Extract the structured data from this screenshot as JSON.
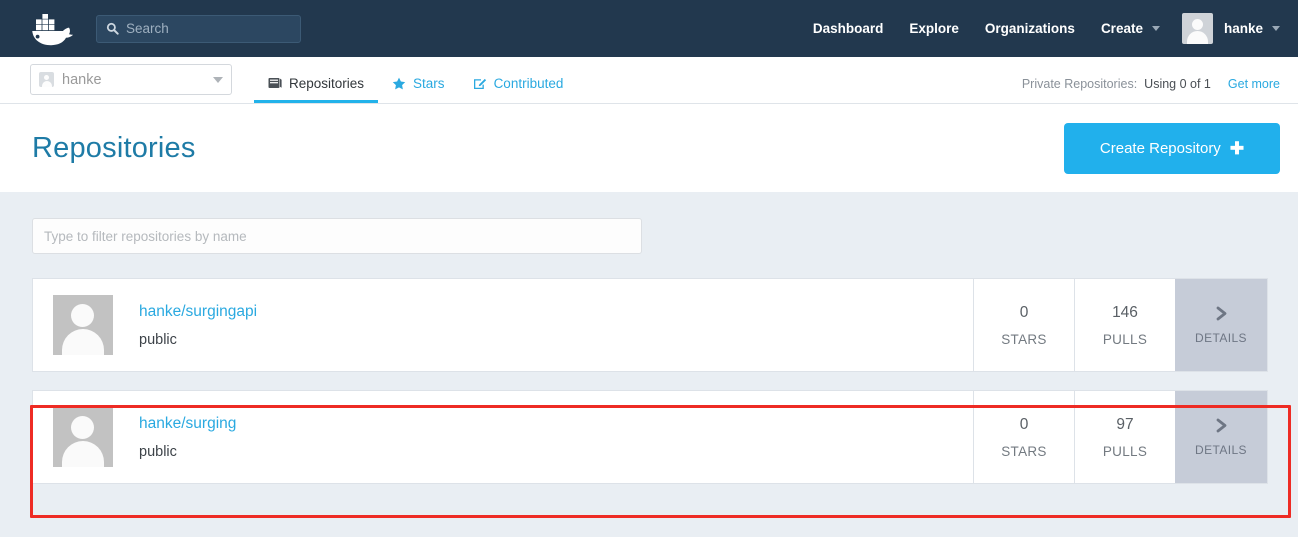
{
  "topnav": {
    "logo_icon": "docker-whale-logo",
    "search": {
      "icon": "search-icon",
      "placeholder": "Search",
      "value": ""
    },
    "links": [
      {
        "label": "Dashboard",
        "name": "dashboard"
      },
      {
        "label": "Explore",
        "name": "explore"
      },
      {
        "label": "Organizations",
        "name": "organizations"
      }
    ],
    "create_menu": {
      "label": "Create",
      "caret_icon": "chevron-down-icon"
    },
    "user_menu": {
      "label": "hanke",
      "avatar_icon": "user-avatar-icon",
      "caret_icon": "chevron-down-icon"
    },
    "bg_color": "#22384e"
  },
  "subheader": {
    "account_select": {
      "value": "hanke",
      "avatar_icon": "user-avatar-icon",
      "caret_icon": "caret-down-icon"
    },
    "tabs": [
      {
        "label": "Repositories",
        "icon": "book-icon",
        "active": true
      },
      {
        "label": "Stars",
        "icon": "star-icon",
        "active": false
      },
      {
        "label": "Contributed",
        "icon": "pencil-square-icon",
        "active": false
      }
    ],
    "private_repos": {
      "label": "Private Repositories:",
      "value": "Using 0 of 1",
      "link": "Get more"
    }
  },
  "titlebar": {
    "title": "Repositories",
    "create_button": {
      "label": "Create Repository",
      "plus": "✚",
      "color": "#21b0ec"
    }
  },
  "filter": {
    "placeholder": "Type to filter repositories by name",
    "value": ""
  },
  "repositories": [
    {
      "name": "hanke/surgingapi",
      "visibility": "public",
      "avatar_icon": "repo-avatar-icon",
      "stars": "0",
      "stars_label": "STARS",
      "pulls": "146",
      "pulls_label": "PULLS",
      "details_label": "DETAILS",
      "details_icon": "chevron-right-icon",
      "highlighted": false
    },
    {
      "name": "hanke/surging",
      "visibility": "public",
      "avatar_icon": "repo-avatar-icon",
      "stars": "0",
      "stars_label": "STARS",
      "pulls": "97",
      "pulls_label": "PULLS",
      "details_label": "DETAILS",
      "details_icon": "chevron-right-icon",
      "highlighted": true
    }
  ],
  "annotation": {
    "color": "#ee2b24",
    "target": "hanke/surging"
  }
}
